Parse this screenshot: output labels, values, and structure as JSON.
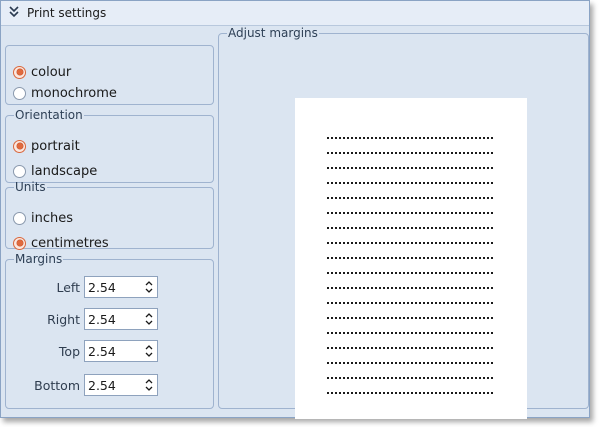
{
  "title": "Print settings",
  "color_group": {
    "options": [
      {
        "label": "colour",
        "selected": true
      },
      {
        "label": "monochrome",
        "selected": false
      }
    ]
  },
  "orientation_group": {
    "legend": "Orientation",
    "options": [
      {
        "label": "portrait",
        "selected": true
      },
      {
        "label": "landscape",
        "selected": false
      }
    ]
  },
  "units_group": {
    "legend": "Units",
    "options": [
      {
        "label": "inches",
        "selected": false
      },
      {
        "label": "centimetres",
        "selected": true
      }
    ]
  },
  "margins_group": {
    "legend": "Margins",
    "fields": [
      {
        "label": "Left",
        "value": "2.54"
      },
      {
        "label": "Right",
        "value": "2.54"
      },
      {
        "label": "Top",
        "value": "2.54"
      },
      {
        "label": "Bottom",
        "value": "2.54"
      }
    ]
  },
  "adjust_panel": {
    "legend": "Adjust margins"
  },
  "colors": {
    "window_bg": "#dbe5f1",
    "border": "#9fb3cf",
    "radio_selected": "#e06a3e"
  },
  "icons": {
    "collapse": "double-chevron-down-icon",
    "spinner": "spinner-arrows-icon"
  }
}
